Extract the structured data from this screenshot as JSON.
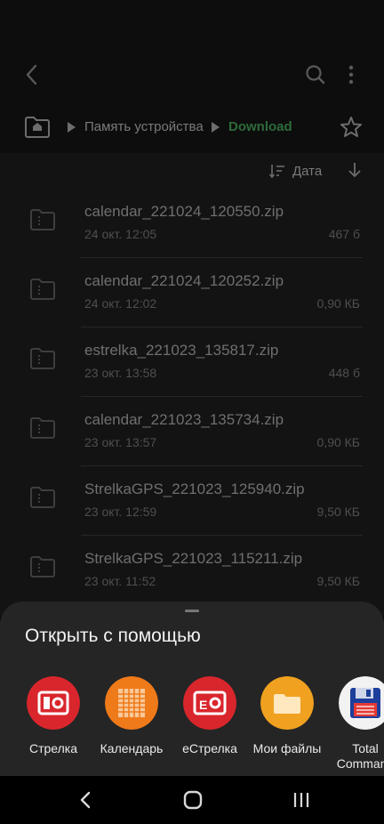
{
  "breadcrumb": {
    "storage": "Память устройства",
    "current": "Download"
  },
  "sort": {
    "label": "Дата"
  },
  "files": [
    {
      "name": "calendar_221024_120550.zip",
      "date": "24 окт. 12:05",
      "size": "467 б"
    },
    {
      "name": "calendar_221024_120252.zip",
      "date": "24 окт. 12:02",
      "size": "0,90 КБ"
    },
    {
      "name": "estrelka_221023_135817.zip",
      "date": "23 окт. 13:58",
      "size": "448 б"
    },
    {
      "name": "calendar_221023_135734.zip",
      "date": "23 окт. 13:57",
      "size": "0,90 КБ"
    },
    {
      "name": "StrelkaGPS_221023_125940.zip",
      "date": "23 окт. 12:59",
      "size": "9,50 КБ"
    },
    {
      "name": "StrelkaGPS_221023_115211.zip",
      "date": "23 окт. 11:52",
      "size": "9,50 КБ"
    }
  ],
  "sheet": {
    "title": "Открыть с помощью",
    "apps": [
      {
        "label": "Стрелка",
        "icon": "strelka-app-icon",
        "color": "#d9262d"
      },
      {
        "label": "Календарь",
        "icon": "calendar-app-icon",
        "color": "#ef7a1a"
      },
      {
        "label": "eСтрелка",
        "icon": "estrelka-app-icon",
        "color": "#d9262d"
      },
      {
        "label": "Мои файлы",
        "icon": "my-files-app-icon",
        "color": "#f0a11f"
      },
      {
        "label": "Total Commander",
        "label_line1": "Total",
        "label_line2": "Command",
        "icon": "total-commander-app-icon",
        "color": "#f2f2f2"
      }
    ]
  },
  "colors": {
    "accent_current_folder": "#2e6b3a",
    "sheet_background": "#252525"
  }
}
